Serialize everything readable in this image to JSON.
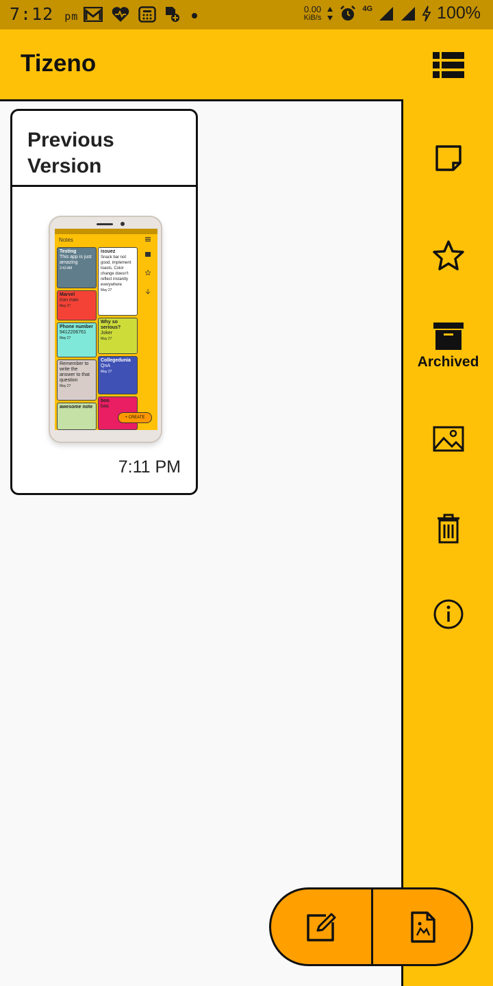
{
  "status_bar": {
    "time": "7:12",
    "ampm": "pm",
    "net_speed_value": "0.00",
    "net_speed_unit": "KiB/s",
    "network": "4G",
    "battery": "100%"
  },
  "app_bar": {
    "title": "Tizeno",
    "view_toggle_icon": "grid-list-icon"
  },
  "notes": [
    {
      "title": "Previous Version",
      "time": "7:11 PM",
      "thumbnail": {
        "header": "Notes",
        "cards": [
          {
            "title": "Testing",
            "body": "This app is just amazing",
            "date": "2:43 AM",
            "color": "#607d8b"
          },
          {
            "title": "issuez",
            "body": "Snack bar not good, implement toasts, Color change doesn't reflect instantly everywhere",
            "date": "May 27",
            "color": "#ffffff"
          },
          {
            "title": "Marvel",
            "body": "Iron man",
            "date": "May 27",
            "color": "#f44336"
          },
          {
            "title": "Why so serious?",
            "body": "Joker",
            "date": "May 27",
            "color": "#cddc39"
          },
          {
            "title": "Phone number",
            "body": "9412206761",
            "date": "May 27",
            "color": "#80e8d8"
          },
          {
            "title": "Collegedunia",
            "body": "QnA",
            "date": "May 27",
            "color": "#3f51b5"
          },
          {
            "title": "Remember to write the answer to that question",
            "body": "",
            "date": "May 27",
            "color": "#d7ccc8"
          },
          {
            "title": "boo",
            "body": "baa",
            "date": "",
            "color": "#e91e63"
          },
          {
            "title": "awesome note",
            "body": "",
            "date": "",
            "color": "#c5e1a5"
          }
        ],
        "create_label": "CREATE"
      }
    }
  ],
  "sidebar": {
    "items": [
      {
        "icon": "note-icon",
        "label": ""
      },
      {
        "icon": "star-icon",
        "label": ""
      },
      {
        "icon": "archive-icon",
        "label": "Archived"
      },
      {
        "icon": "image-icon",
        "label": ""
      },
      {
        "icon": "trash-icon",
        "label": ""
      },
      {
        "icon": "info-icon",
        "label": ""
      }
    ]
  },
  "fab": {
    "left_icon": "edit-note-icon",
    "right_icon": "image-file-icon",
    "color": "#ff9f00"
  },
  "colors": {
    "primary": "#ffc107",
    "status_bar": "#c59200",
    "accent": "#ff9f00"
  }
}
